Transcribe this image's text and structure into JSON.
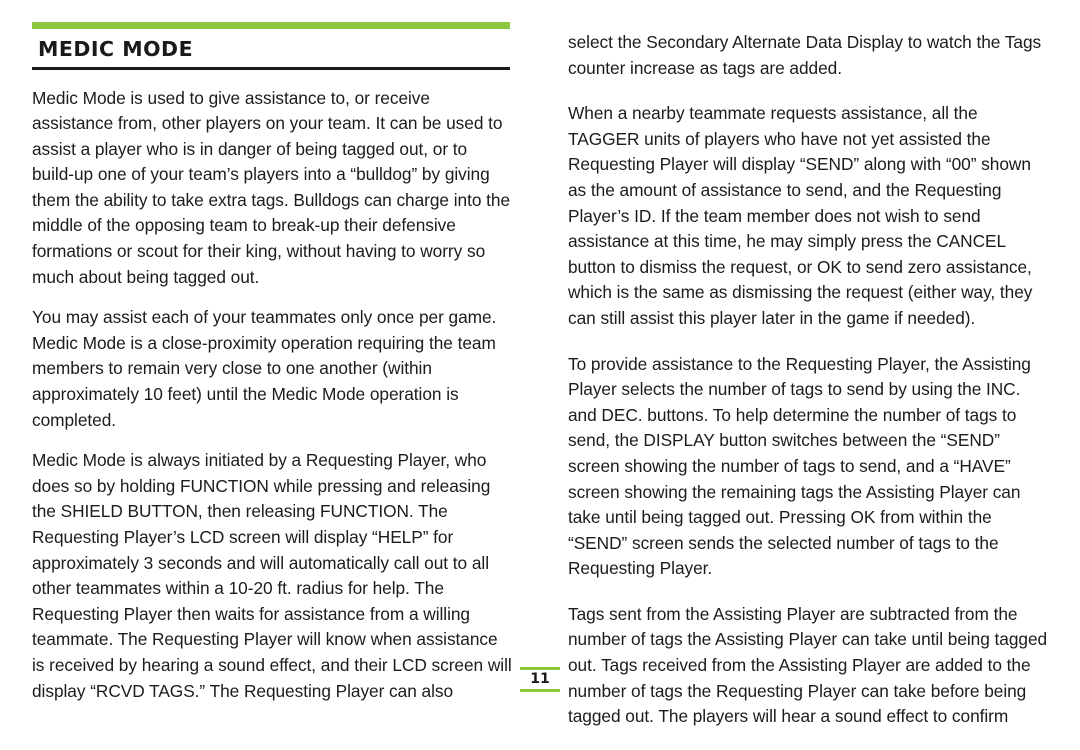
{
  "page": {
    "section_title": "MEDIC MODE",
    "page_number": "11",
    "accent_color": "#8cc63f",
    "text_color": "#1a1a1a"
  },
  "left_column": {
    "paragraphs": [
      "Medic Mode is used to give assistance to, or receive assistance from, other players on your team. It can be used to assist a player who is in danger of being tagged out, or to build-up one of your team’s players into a “bulldog” by giving them the ability to take extra tags. Bulldogs can charge into the middle of the opposing team to break-up their defensive formations or scout for their king, without having to worry so much about being tagged out.",
      "You may assist each of your teammates only once per game. Medic Mode is a close-proximity operation requiring the team members to remain very close to one another (within approximately 10 feet) until the Medic Mode operation is completed.",
      "Medic Mode is always initiated by a Requesting Player, who does so by holding FUNCTION while pressing and releasing the SHIELD BUTTON, then releasing FUNCTION. The Requesting Player’s LCD screen will display “HELP” for approximately 3 seconds and will automatically call out to all other teammates within a 10-20 ft. radius for help. The Requesting Player then waits for assistance from a willing teammate. The Requesting Player will know when assistance is received by hearing a sound effect, and their LCD screen will display “RCVD TAGS.” The Requesting Player can also"
    ]
  },
  "right_column": {
    "paragraphs": [
      "select the Secondary Alternate Data Display to watch the Tags counter increase as tags are added.",
      "When a nearby teammate requests assistance, all the TAGGER units of players who have not yet assisted the Requesting Player will display “SEND” along with “00” shown as the amount of assistance to send, and the Requesting Player’s ID. If the team member does not wish to send assistance at this time, he may simply press the CANCEL button to dismiss the request, or OK to send zero assistance, which is the same as dismissing the request (either way, they can still assist this player later in the game if needed).",
      "To provide assistance to the Requesting Player, the Assisting Player selects the number of tags to send by using the INC. and DEC. buttons. To help determine the number of tags to send, the DISPLAY button switches between the “SEND” screen showing the number of tags to send, and a “HAVE” screen showing the remaining tags the Assisting Player can take until being tagged out. Pressing OK from within the “SEND” screen sends the selected number of tags to the Requesting Player.",
      "Tags sent from the Assisting Player are subtracted from the number of tags the Assisting Player can take until being tagged out. Tags received from the Assisting Player are added to the number of tags the Requesting Player can take before being tagged out. The players will hear a sound effect to confirm"
    ]
  }
}
